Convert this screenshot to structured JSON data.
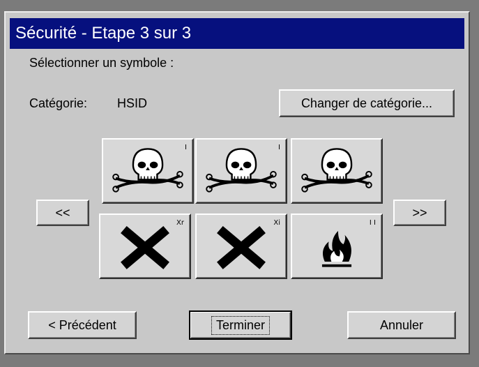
{
  "dialog": {
    "title": "Sécurité - Etape 3 sur 3",
    "prompt": "Sélectionner un symbole :",
    "category_label": "Catégorie:",
    "category_value": "HSID",
    "change_category_button": "Changer de catégorie...",
    "prev_page_button": "<<",
    "next_page_button": ">>",
    "symbols": [
      {
        "icon": "skull-crossbones-icon",
        "tag": "I"
      },
      {
        "icon": "skull-crossbones-icon",
        "tag": "I"
      },
      {
        "icon": "skull-crossbones-icon",
        "tag": ""
      },
      {
        "icon": "x-harmful-icon",
        "tag": "Xr"
      },
      {
        "icon": "x-irritant-icon",
        "tag": "Xi"
      },
      {
        "icon": "flame-icon",
        "tag": "I I"
      }
    ],
    "buttons": {
      "previous": "< Précédent",
      "finish": "Terminer",
      "cancel": "Annuler"
    }
  },
  "colors": {
    "titlebar": "#06107e",
    "dialog_bg": "#c8c8c8",
    "outer_bg": "#7b7b7b"
  }
}
